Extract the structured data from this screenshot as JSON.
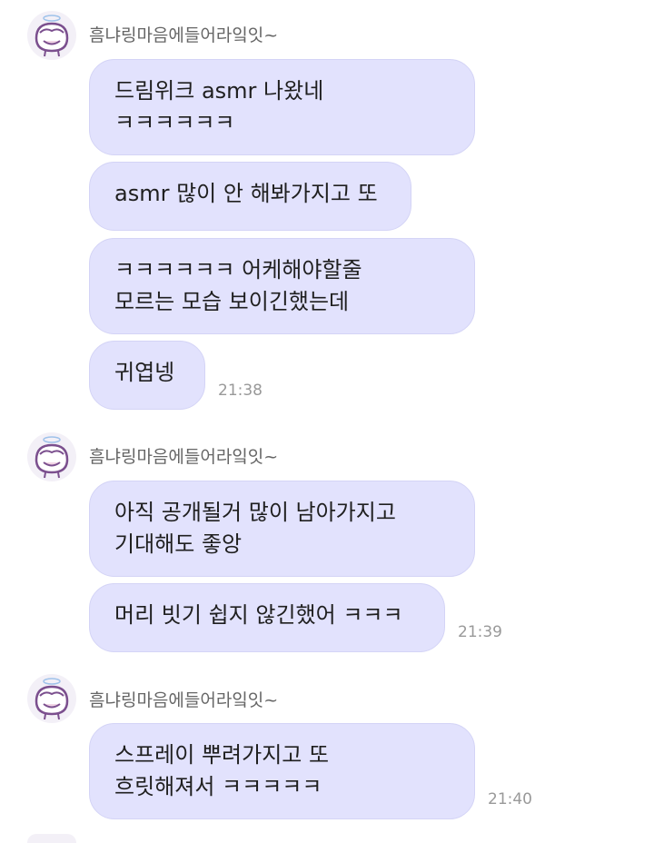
{
  "groups": [
    {
      "sender": "흠냐링마음에들어라잌잇~",
      "messages": [
        {
          "lines": [
            "드림위크 asmr 나왔네",
            "ㅋㅋㅋㅋㅋㅋ"
          ],
          "time": ""
        },
        {
          "lines": [
            "asmr 많이 안 해봐가지고 또"
          ],
          "time": ""
        },
        {
          "lines": [
            "ㅋㅋㅋㅋㅋㅋ 어케해야할줄",
            "모르는 모습 보이긴했는데"
          ],
          "time": ""
        },
        {
          "lines": [
            "귀엽넹"
          ],
          "time": "21:38"
        }
      ]
    },
    {
      "sender": "흠냐링마음에들어라잌잇~",
      "messages": [
        {
          "lines": [
            "아직 공개될거 많이 남아가지고",
            "기대해도 좋앙"
          ],
          "time": ""
        },
        {
          "lines": [
            "머리 빗기 쉽지 않긴했어 ㅋㅋㅋ"
          ],
          "time": "21:39"
        }
      ]
    },
    {
      "sender": "흠냐링마음에들어라잌잇~",
      "messages": [
        {
          "lines": [
            "스프레이 뿌려가지고 또",
            "흐릿해져서 ㅋㅋㅋㅋㅋ"
          ],
          "time": "21:40"
        }
      ]
    }
  ]
}
